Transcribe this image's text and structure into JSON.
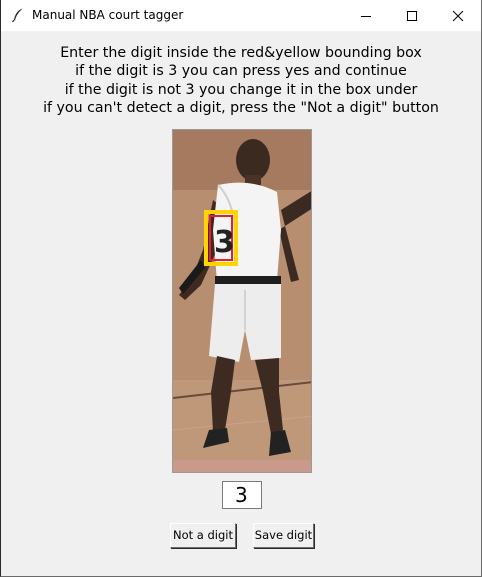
{
  "window": {
    "title": "Manual NBA court tagger",
    "app_icon": "feather-icon",
    "controls": [
      "minimize-icon",
      "maximize-icon",
      "close-icon"
    ]
  },
  "instructions": {
    "line1": "Enter the digit inside the red&yellow bounding box",
    "line2": "if the digit is 3 you can press yes and continue",
    "line3": "if the digit is not 3 you change it in the box under",
    "line4": "if you can't detect a digit, press the \"Not a digit\" button"
  },
  "image": {
    "subject": "player crop",
    "box_colors": {
      "outer": "#ffd400",
      "inner": "#e0202a"
    }
  },
  "digit_input": {
    "value": "3"
  },
  "buttons": {
    "not_digit": "Not a digit",
    "save_digit": "Save digit"
  }
}
